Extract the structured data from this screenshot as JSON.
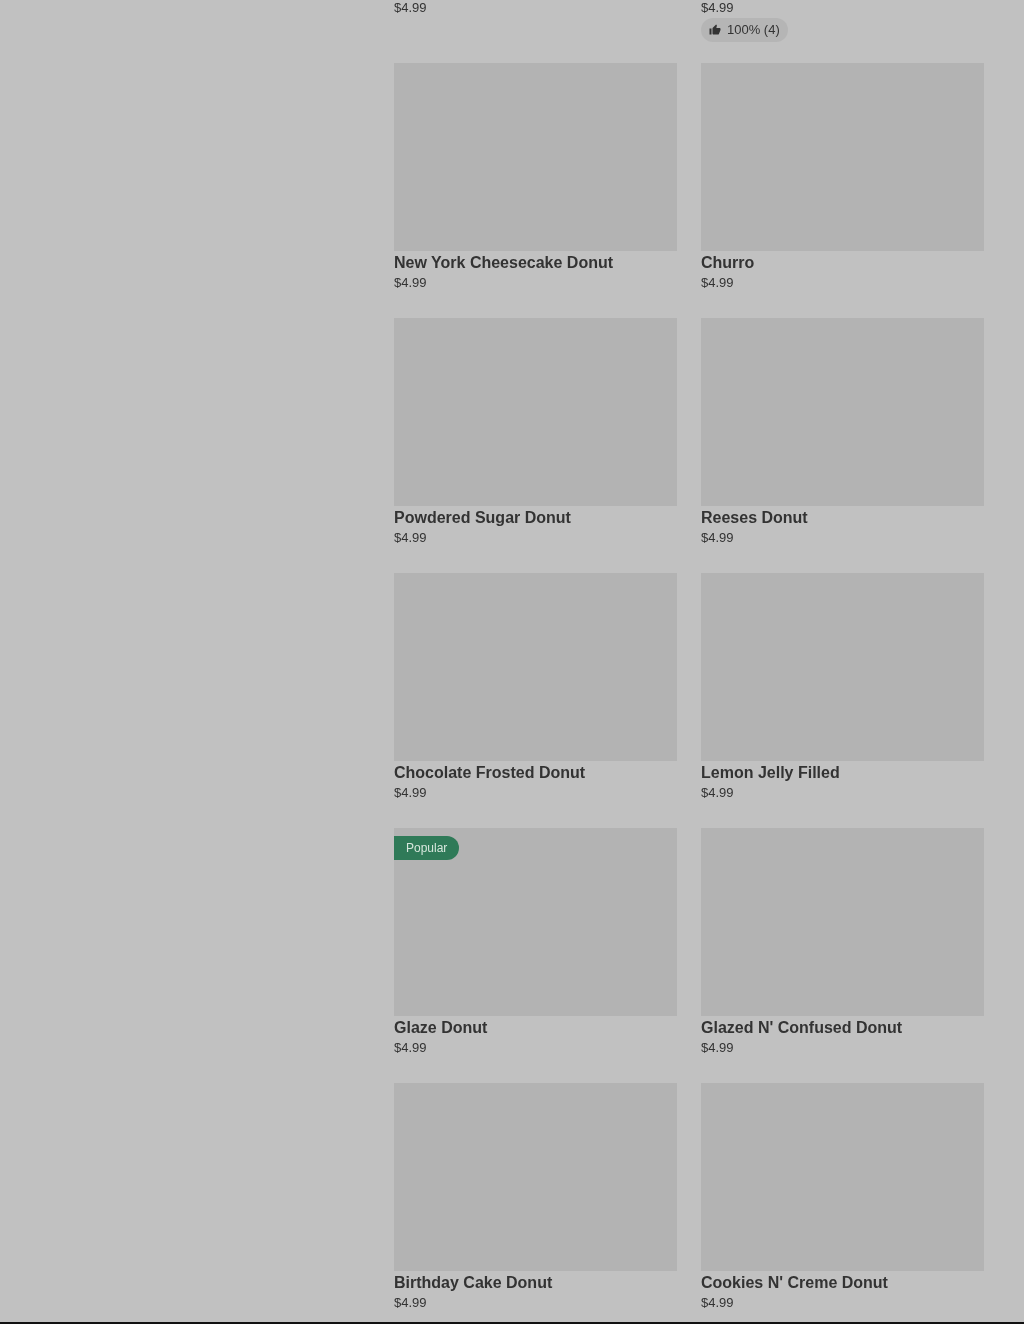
{
  "top_row": [
    {
      "price": "$4.99"
    },
    {
      "price": "$4.99",
      "rating": "100% (4)"
    }
  ],
  "products": [
    {
      "name": "New York Cheesecake Donut",
      "price": "$4.99"
    },
    {
      "name": "Churro",
      "price": "$4.99"
    },
    {
      "name": "Powdered Sugar Donut",
      "price": "$4.99"
    },
    {
      "name": "Reeses Donut",
      "price": "$4.99"
    },
    {
      "name": "Chocolate Frosted Donut",
      "price": "$4.99"
    },
    {
      "name": "Lemon Jelly Filled",
      "price": "$4.99"
    },
    {
      "name": "Glaze Donut",
      "price": "$4.99",
      "badge": "Popular"
    },
    {
      "name": "Glazed N' Confused Donut",
      "price": "$4.99"
    },
    {
      "name": "Birthday Cake Donut",
      "price": "$4.99"
    },
    {
      "name": "Cookies N' Creme Donut",
      "price": "$4.99"
    }
  ]
}
